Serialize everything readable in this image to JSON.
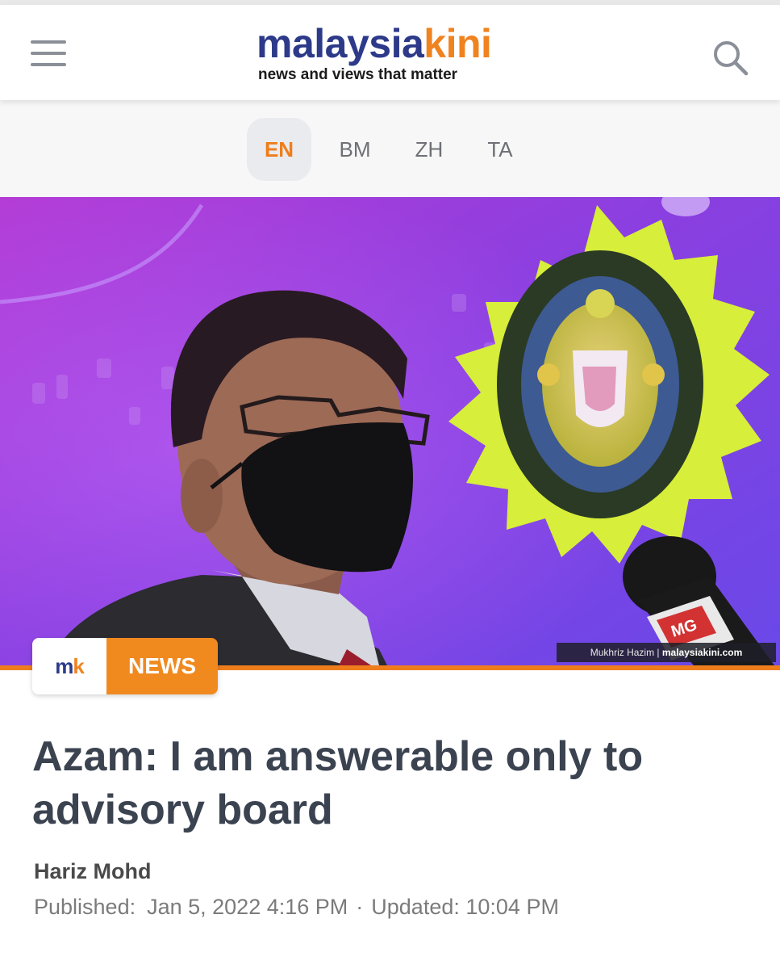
{
  "header": {
    "logo_part1": "malaysia",
    "logo_part2": "kini",
    "tagline": "news and views that matter",
    "menu_icon": "hamburger-menu-icon",
    "search_icon": "search-icon"
  },
  "languages": [
    {
      "code": "EN",
      "active": true
    },
    {
      "code": "BM",
      "active": false
    },
    {
      "code": "ZH",
      "active": false
    },
    {
      "code": "TA",
      "active": false
    }
  ],
  "hero": {
    "credit_name": "Mukhriz Hazim",
    "credit_site": "malaysiakini.com",
    "mic_label": "MG"
  },
  "badge": {
    "logo_m": "m",
    "logo_k": "k",
    "label": "NEWS"
  },
  "article": {
    "headline": "Azam: I am answerable only to advisory board",
    "author": "Hariz Mohd",
    "published_label": "Published:",
    "published_value": "Jan 5, 2022 4:16 PM",
    "separator": "·",
    "updated_label": "Updated:",
    "updated_value": "10:04 PM"
  },
  "colors": {
    "brand_blue": "#2d3a89",
    "brand_orange": "#f0831f",
    "headline": "#3b4350"
  }
}
